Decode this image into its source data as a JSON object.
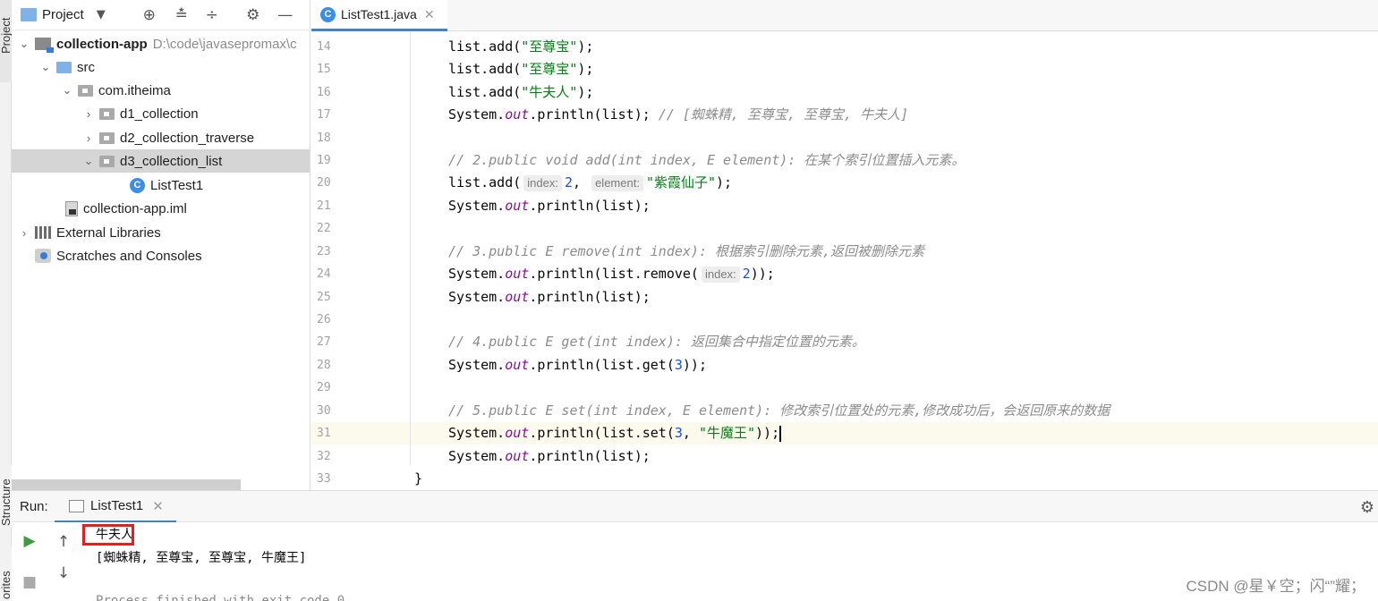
{
  "side_strip": {
    "top_label": "Project",
    "mid_label": "Structure",
    "bottom_label": "orites"
  },
  "project_panel": {
    "title": "Project",
    "tree": [
      {
        "label": "collection-app",
        "path": "D:\\code\\javasepromax\\c"
      },
      {
        "label": "src"
      },
      {
        "label": "com.itheima"
      },
      {
        "label": "d1_collection"
      },
      {
        "label": "d2_collection_traverse"
      },
      {
        "label": "d3_collection_list"
      },
      {
        "label": "ListTest1"
      },
      {
        "label": "collection-app.iml"
      },
      {
        "label": "External Libraries"
      },
      {
        "label": "Scratches and Consoles"
      }
    ]
  },
  "editor": {
    "tab": {
      "label": "ListTest1.java",
      "icon": "class-icon"
    },
    "line_numbers": [
      "14",
      "15",
      "16",
      "17",
      "18",
      "19",
      "20",
      "21",
      "22",
      "23",
      "24",
      "25",
      "26",
      "27",
      "28",
      "29",
      "30",
      "31",
      "32",
      "33"
    ],
    "current_line": "31",
    "code": {
      "l14": {
        "a": "list.add(",
        "s": "\"至尊宝\"",
        "b": ");"
      },
      "l15": {
        "a": "list.add(",
        "s": "\"至尊宝\"",
        "b": ");"
      },
      "l16": {
        "a": "list.add(",
        "s": "\"牛夫人\"",
        "b": ");"
      },
      "l17": {
        "a": "System.",
        "f": "out",
        "b": ".println(list); ",
        "c": "// [蜘蛛精, 至尊宝, 至尊宝, 牛夫人]"
      },
      "l19": {
        "c": "// 2.public void add(int index, E element): 在某个索引位置插入元素。"
      },
      "l20": {
        "a": "list.add(",
        "h1": "index:",
        "n1": "2",
        "m": ", ",
        "h2": "element:",
        "s": "\"紫霞仙子\"",
        "b": ");"
      },
      "l21": {
        "a": "System.",
        "f": "out",
        "b": ".println(list);"
      },
      "l23": {
        "c": "// 3.public E remove(int index): 根据索引删除元素,返回被删除元素"
      },
      "l24": {
        "a": "System.",
        "f": "out",
        "b": ".println(list.remove(",
        "h1": "index:",
        "n1": "2",
        "e": "));"
      },
      "l25": {
        "a": "System.",
        "f": "out",
        "b": ".println(list);"
      },
      "l27": {
        "c": "// 4.public E get(int index): 返回集合中指定位置的元素。"
      },
      "l28": {
        "a": "System.",
        "f": "out",
        "b": ".println(list.get(",
        "n1": "3",
        "e": "));"
      },
      "l30": {
        "c": "// 5.public E set(int index, E element): 修改索引位置处的元素,修改成功后，会返回原来的数据"
      },
      "l31": {
        "a": "System.",
        "f": "out",
        "b": ".println(list.set(",
        "n1": "3",
        "m": ", ",
        "s": "\"牛魔王\"",
        "e": "));"
      },
      "l32": {
        "a": "System.",
        "f": "out",
        "b": ".println(list);"
      },
      "l33": {
        "a": "}"
      }
    }
  },
  "run_panel": {
    "label": "Run:",
    "tab_label": "ListTest1",
    "output": [
      "牛夫人",
      "[蜘蛛精, 至尊宝, 至尊宝, 牛魔王]",
      "Process finished with exit code 0"
    ]
  },
  "watermark": "CSDN @星￥空；闪“”耀；"
}
